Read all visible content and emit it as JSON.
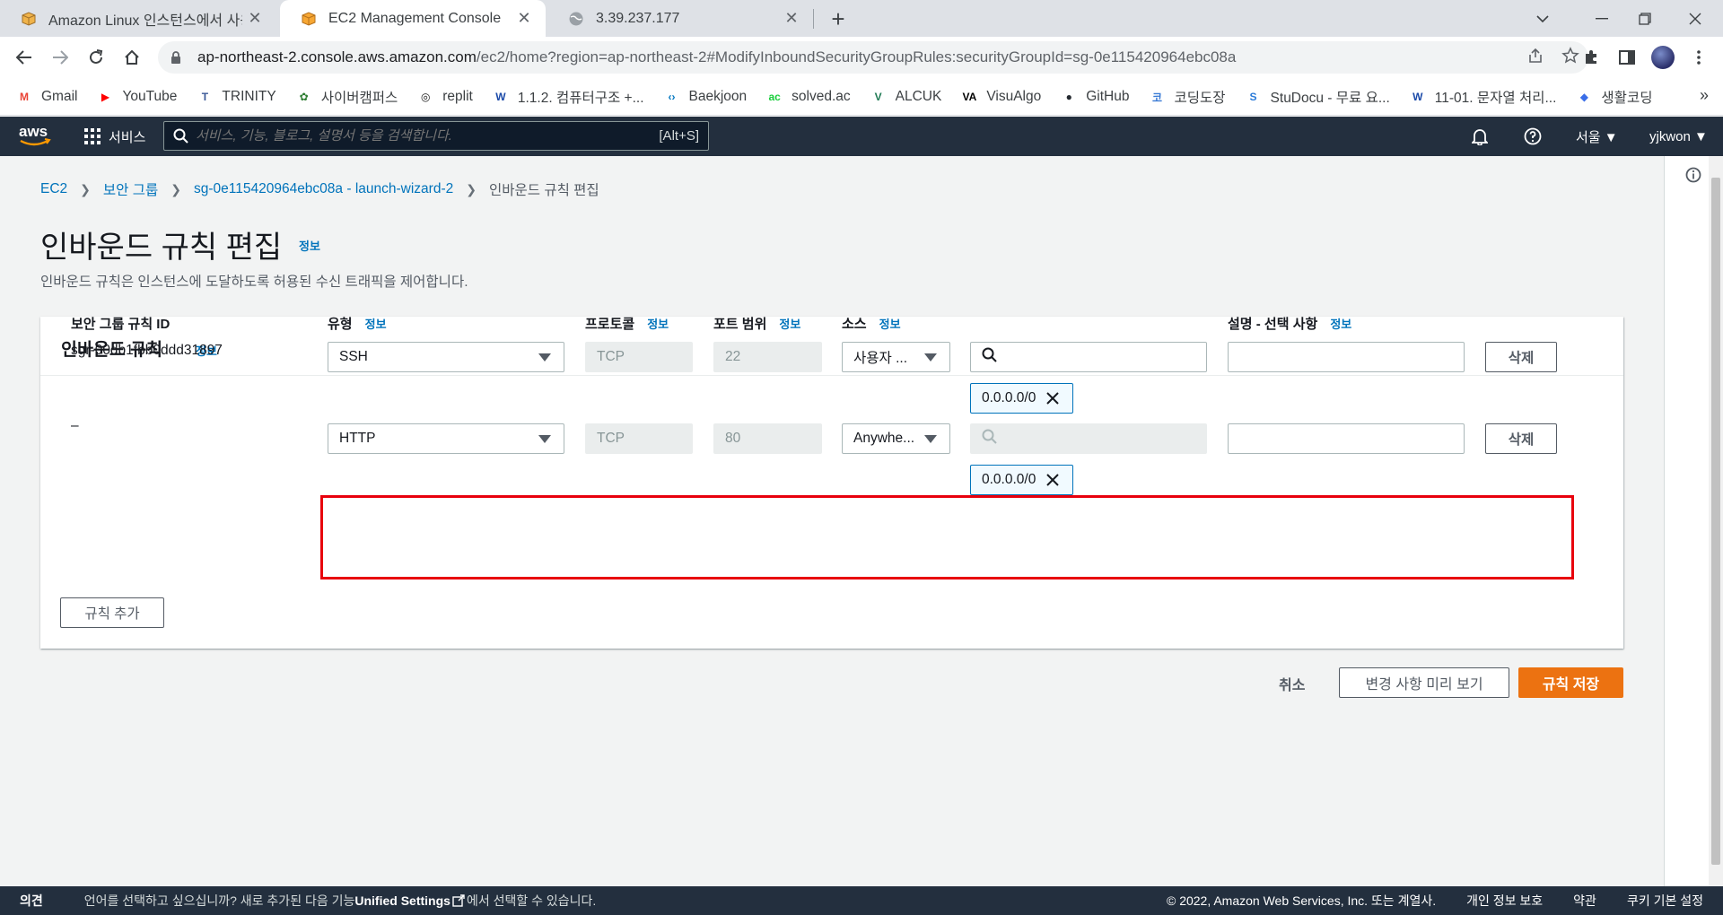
{
  "browser": {
    "tabs": [
      {
        "title": "Amazon Linux 인스턴스에서 사용",
        "icon": "box-icon"
      },
      {
        "title": "EC2 Management Console",
        "icon": "aws-ec2-icon"
      },
      {
        "title": "3.39.237.177",
        "icon": "globe-icon"
      }
    ],
    "url_host": "ap-northeast-2.console.aws.amazon.com",
    "url_path": "/ec2/home?region=ap-northeast-2#ModifyInboundSecurityGroupRules:securityGroupId=sg-0e115420964ebc08a"
  },
  "bookmarks": [
    {
      "label": "Gmail",
      "color": "#ea4335",
      "glyph": "M"
    },
    {
      "label": "YouTube",
      "color": "#ff0000",
      "glyph": "▶"
    },
    {
      "label": "TRINITY",
      "color": "#3b5998",
      "glyph": "T"
    },
    {
      "label": "사이버캠퍼스",
      "color": "#2e7d32",
      "glyph": "✿"
    },
    {
      "label": "replit",
      "color": "#1b1b1b",
      "glyph": "◎"
    },
    {
      "label": "1.1.2. 컴퓨터구조 +...",
      "color": "#1a49a8",
      "glyph": "W"
    },
    {
      "label": "Baekjoon",
      "color": "#0076c0",
      "glyph": "‹›"
    },
    {
      "label": "solved.ac",
      "color": "#17ce3a",
      "glyph": "ac"
    },
    {
      "label": "ALCUK",
      "color": "#1f7a54",
      "glyph": "V"
    },
    {
      "label": "VisuAlgo",
      "color": "#000000",
      "glyph": "VA"
    },
    {
      "label": "GitHub",
      "color": "#24292f",
      "glyph": "●"
    },
    {
      "label": "코딩도장",
      "color": "#3a7bd5",
      "glyph": "코"
    },
    {
      "label": "StuDocu - 무료 요...",
      "color": "#2b7bd9",
      "glyph": "S"
    },
    {
      "label": "11-01. 문자열 처리...",
      "color": "#1a49a8",
      "glyph": "W"
    },
    {
      "label": "생활코딩",
      "color": "#3a6ee8",
      "glyph": "◆"
    }
  ],
  "aws": {
    "services_label": "서비스",
    "search_placeholder": "서비스, 기능, 블로그, 설명서 등을 검색합니다.",
    "search_shortcut": "[Alt+S]",
    "region": "서울 ▼",
    "user": "yjkwon ▼"
  },
  "breadcrumb": [
    "EC2",
    "보안 그룹",
    "sg-0e115420964ebc08a - launch-wizard-2",
    "인바운드 규칙 편집"
  ],
  "page": {
    "title": "인바운드 규칙 편집",
    "info": "정보",
    "description": "인바운드 규칙은 인스턴스에 도달하도록 허용된 수신 트래픽을 제어합니다."
  },
  "panel": {
    "title": "인바운드 규칙",
    "info": "정보",
    "columns": {
      "rule_id": "보안 그룹 규칙 ID",
      "type": "유형",
      "protocol": "프로토콜",
      "port": "포트 범위",
      "source": "소스",
      "description": "설명 - 선택 사항",
      "info": "정보"
    },
    "rules": [
      {
        "id": "sgr-00db1fbb0ddd31897",
        "type": "SSH",
        "protocol": "TCP",
        "port": "22",
        "source": "사용자 ...",
        "cidr": "0.0.0.0/0",
        "delete": "삭제"
      },
      {
        "id": "–",
        "type": "HTTP",
        "protocol": "TCP",
        "port": "80",
        "source": "Anywhe...",
        "cidr": "0.0.0.0/0",
        "delete": "삭제"
      }
    ],
    "add_rule": "규칙 추가"
  },
  "actions": {
    "cancel": "취소",
    "preview": "변경 사항 미리 보기",
    "save": "규칙 저장"
  },
  "footer": {
    "feedback": "의견",
    "message_prefix": "언어를 선택하고 싶으십니까? 새로 추가된 다음 기능",
    "message_link": "Unified Settings",
    "message_suffix": "에서 선택할 수 있습니다.",
    "copyright": "© 2022, Amazon Web Services, Inc. 또는 계열사.",
    "privacy": "개인 정보 보호",
    "terms": "약관",
    "cookies": "쿠키 기본 설정"
  },
  "colors": {
    "accent": "#0073bb",
    "primary_button": "#ec7211",
    "highlight": "#e8000d",
    "aws_nav": "#232f3e"
  }
}
